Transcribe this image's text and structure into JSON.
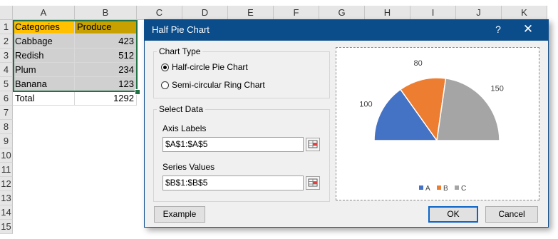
{
  "sheet": {
    "columns": [
      "A",
      "B",
      "C",
      "D",
      "E",
      "F",
      "G",
      "H",
      "I",
      "J",
      "K"
    ],
    "rows": [
      "1",
      "2",
      "3",
      "4",
      "5",
      "6",
      "7",
      "8",
      "9",
      "10",
      "11",
      "12",
      "13",
      "14",
      "15"
    ],
    "header": {
      "categories": "Categories",
      "produce": "Produce"
    },
    "data": [
      {
        "name": "Cabbage",
        "value": "423"
      },
      {
        "name": "Redish",
        "value": "512"
      },
      {
        "name": "Plum",
        "value": "234"
      },
      {
        "name": "Banana",
        "value": "123"
      }
    ],
    "total": {
      "label": "Total",
      "value": "1292"
    }
  },
  "dialog": {
    "title": "Half Pie Chart",
    "help": "?",
    "close": "✕",
    "chart_type": {
      "legend": "Chart Type",
      "option1": "Half-circle Pie Chart",
      "option2": "Semi-circular Ring Chart",
      "selected": "option1"
    },
    "select_data": {
      "legend": "Select Data",
      "axis_labels_label": "Axis Labels",
      "axis_labels_value": "$A$1:$A$5",
      "series_values_label": "Series Values",
      "series_values_value": "$B$1:$B$5"
    },
    "buttons": {
      "example": "Example",
      "ok": "OK",
      "cancel": "Cancel"
    }
  },
  "chart_data": {
    "type": "pie",
    "subtype": "half-pie",
    "categories": [
      "A",
      "B",
      "C"
    ],
    "values": [
      100,
      80,
      150
    ],
    "colors": [
      "#4472c4",
      "#ed7d31",
      "#a5a5a5"
    ],
    "data_labels": [
      "100",
      "80",
      "150"
    ],
    "legend": [
      "A",
      "B",
      "C"
    ],
    "legend_position": "bottom"
  }
}
